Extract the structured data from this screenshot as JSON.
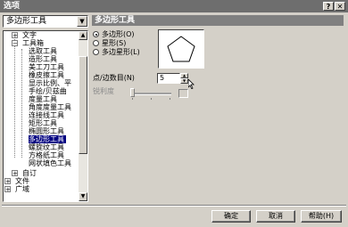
{
  "window": {
    "title": "选项",
    "help_glyph": "?",
    "close_glyph": "✕"
  },
  "category_combo": {
    "value": "多边形工具",
    "arrow": "▼"
  },
  "tree": {
    "items": [
      {
        "label": "文字",
        "expander": "+"
      },
      {
        "label": "工具箱",
        "expander": "−"
      },
      {
        "label": "选取工具"
      },
      {
        "label": "造形工具"
      },
      {
        "label": "美工刀工具"
      },
      {
        "label": "橡皮擦工具"
      },
      {
        "label": "显示比例、平"
      },
      {
        "label": "手绘/贝兹曲"
      },
      {
        "label": "度量工具"
      },
      {
        "label": "角度度量工具"
      },
      {
        "label": "连接线工具"
      },
      {
        "label": "矩形工具"
      },
      {
        "label": "椭圆形工具"
      },
      {
        "label": "多边形工具",
        "selected": true
      },
      {
        "label": "螺旋纹工具"
      },
      {
        "label": "方格纸工具"
      },
      {
        "label": "网状填色工具"
      },
      {
        "label": "自订",
        "expander": "+"
      },
      {
        "label": "文件",
        "expander": "+"
      },
      {
        "label": "广域",
        "expander": "+"
      }
    ],
    "scroll_up": "▲",
    "scroll_down": "▼"
  },
  "section": {
    "title": "多边形工具"
  },
  "shape_options": [
    {
      "label": "多边形(O)",
      "checked": true
    },
    {
      "label": "星形(S)",
      "checked": false
    },
    {
      "label": "多边星形(L)",
      "checked": false
    }
  ],
  "points": {
    "label": "点/边数目(N)",
    "value": "5",
    "up": "▲",
    "down": "▼"
  },
  "sharpness": {
    "label": "锐利度"
  },
  "buttons": {
    "ok": "确定",
    "cancel": "取消",
    "help": "帮助(H)"
  }
}
